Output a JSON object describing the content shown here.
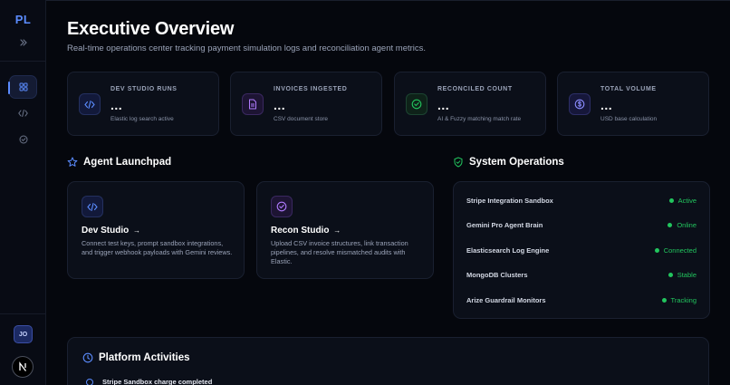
{
  "sidebar": {
    "logo": "PL",
    "icons": [
      "chevrons-right-icon",
      "grid-icon",
      "code-icon",
      "check-circle-icon"
    ],
    "avatar": "JO"
  },
  "header": {
    "title": "Executive Overview",
    "subtitle": "Real-time operations center tracking payment simulation logs and reconciliation agent metrics."
  },
  "stats": [
    {
      "label": "DEV STUDIO RUNS",
      "value": "...",
      "desc": "Elastic log search active",
      "icon": "code-icon",
      "color": "#5b8cff"
    },
    {
      "label": "INVOICES INGESTED",
      "value": "...",
      "desc": "CSV document store",
      "icon": "document-icon",
      "color": "#b07bff"
    },
    {
      "label": "RECONCILED COUNT",
      "value": "...",
      "desc": "AI & Fuzzy matching match rate",
      "icon": "check-circle-icon",
      "color": "#22c55e"
    },
    {
      "label": "TOTAL VOLUME",
      "value": "...",
      "desc": "USD base calculation",
      "icon": "dollar-icon",
      "color": "#8b8cff"
    }
  ],
  "launchpad": {
    "title": "Agent Launchpad",
    "cards": [
      {
        "title": "Dev Studio",
        "arrow": "→",
        "desc": "Connect test keys, prompt sandbox integrations, and trigger webhook payloads with Gemini reviews."
      },
      {
        "title": "Recon Studio",
        "arrow": "→",
        "desc": "Upload CSV invoice structures, link transaction pipelines, and resolve mismatched audits with Elastic."
      }
    ]
  },
  "operations": {
    "title": "System Operations",
    "rows": [
      {
        "name": "Stripe Integration Sandbox",
        "status": "Active"
      },
      {
        "name": "Gemini Pro Agent Brain",
        "status": "Online"
      },
      {
        "name": "Elasticsearch Log Engine",
        "status": "Connected"
      },
      {
        "name": "MongoDB Clusters",
        "status": "Stable"
      },
      {
        "name": "Arize Guardrail Monitors",
        "status": "Tracking"
      }
    ]
  },
  "activities": {
    "title": "Platform Activities",
    "items": [
      {
        "text": "Stripe Sandbox charge completed"
      }
    ]
  },
  "colors": {
    "accent": "#5b8cff",
    "success": "#22c55e",
    "background": "#05070d",
    "card": "#0b0f19"
  }
}
